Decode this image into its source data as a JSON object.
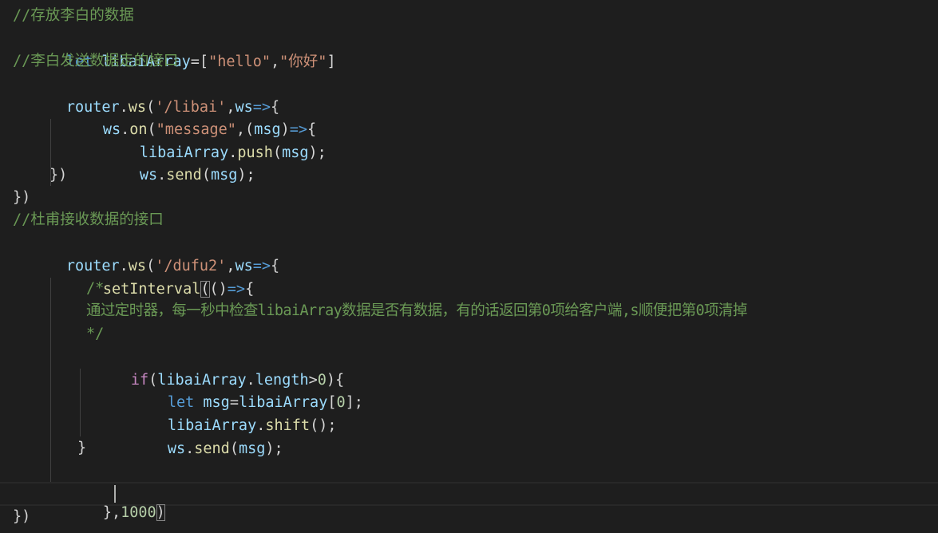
{
  "editor": {
    "top_partial": "    })",
    "lines": [
      {
        "comment": "//存放李白的数据"
      },
      {
        "kw": "let",
        "var": "libaiArray",
        "eq": "=[",
        "str1": "\"hello\"",
        "comma": ",",
        "str2": "\"你好\"",
        "close": "]"
      },
      {
        "comment": "//李白发送数据走的接口"
      },
      {
        "obj": "router",
        "dot": ".",
        "fn": "ws",
        "open": "(",
        "str": "'/libai'",
        "comma": ",",
        "param": "ws",
        "arrow": "=>",
        "brace": "{"
      },
      {
        "obj": "ws",
        "dot": ".",
        "fn": "on",
        "open": "(",
        "str": "\"message\"",
        "comma": ",(",
        "param": "msg",
        "close": ")",
        "arrow": "=>",
        "brace": "{"
      },
      {
        "obj": "libaiArray",
        "dot": ".",
        "fn": "push",
        "open": "(",
        "arg": "msg",
        "close": ");"
      },
      {
        "obj": "ws",
        "dot": ".",
        "fn": "send",
        "open": "(",
        "arg": "msg",
        "close": ");"
      },
      {
        "text": "})"
      },
      {
        "text": "})"
      },
      {
        "comment": "//杜甫接收数据的接口"
      },
      {
        "obj": "router",
        "dot": ".",
        "fn": "ws",
        "open": "(",
        "str": "'/dufu2'",
        "comma": ",",
        "param": "ws",
        "arrow": "=>",
        "brace": "{"
      },
      {
        "fn": "setInterval",
        "open": "(",
        "open2": "()",
        "arrow": "=>",
        "brace": "{"
      },
      {
        "comment": "/*"
      },
      {
        "comment": "通过定时器，每一秒中检查libaiArray数据是否有数据，有的话返回第0项给客户端,s顺便把第0项清掉"
      },
      {
        "comment": "*/"
      },
      {
        "ctrl": "if",
        "open": "(",
        "obj": "libaiArray",
        "dot": ".",
        "prop": "length",
        "op": ">",
        "num": "0",
        "close": "){"
      },
      {
        "kw": "let",
        "var": "msg",
        "eq": "=",
        "obj": "libaiArray",
        "open": "[",
        "num": "0",
        "close": "];"
      },
      {
        "obj": "libaiArray",
        "dot": ".",
        "fn": "shift",
        "close": "();"
      },
      {
        "obj": "ws",
        "dot": ".",
        "fn": "send",
        "open": "(",
        "arg": "msg",
        "close": ");"
      },
      {
        "text": "}"
      },
      {
        "text": ""
      },
      {
        "close1": "},",
        "num": "1000",
        "close2": ")"
      },
      {
        "text": "})"
      }
    ]
  },
  "colors": {
    "background": "#1e1e1e",
    "comment": "#6a9955",
    "keyword": "#569cd6",
    "control": "#c586c0",
    "variable": "#9cdcfe",
    "function": "#dcdcaa",
    "string": "#ce9178",
    "number": "#b5cea8"
  }
}
